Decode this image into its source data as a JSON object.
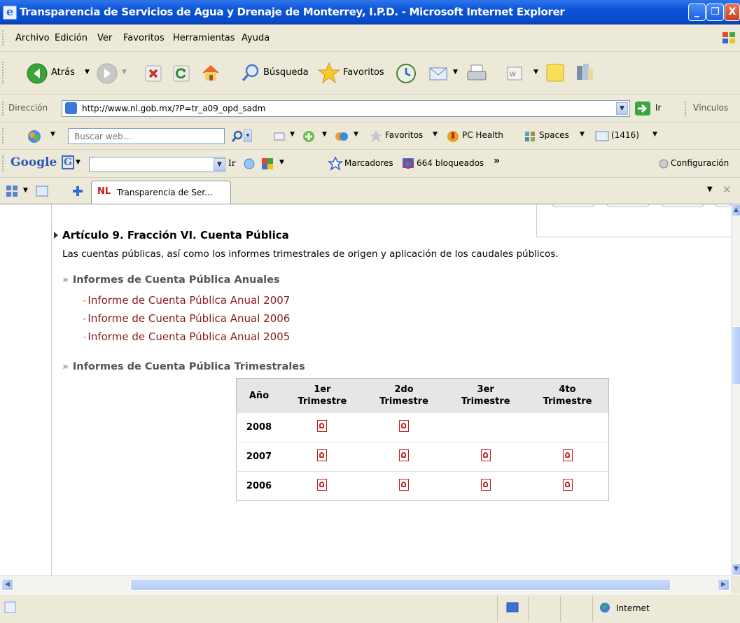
{
  "window": {
    "title": "Transparencia de Servicios de Agua y Drenaje de Monterrey, I.P.D. - Microsoft Internet Explorer",
    "controls": {
      "minimize": "_",
      "maximize": "❐",
      "close": "X"
    }
  },
  "menu": [
    "Archivo",
    "Edición",
    "Ver",
    "Favoritos",
    "Herramientas",
    "Ayuda"
  ],
  "toolbar": {
    "back": "Atrás",
    "search": "Búsqueda",
    "favorites": "Favoritos"
  },
  "address": {
    "label": "Dirección",
    "url": "http://www.nl.gob.mx/?P=tr_a09_opd_sadm",
    "go": "Ir",
    "links": "Vínculos"
  },
  "search_bar": {
    "placeholder": "Buscar web...",
    "favorites": "Favoritos",
    "pc_health": "PC Health",
    "spaces": "Spaces",
    "mail_count": "(1416)"
  },
  "google_bar": {
    "logo": "Google",
    "go": "Ir",
    "bookmarks": "Marcadores",
    "blocked": "664 bloqueados",
    "more": "»",
    "settings": "Configuración"
  },
  "tab": {
    "logo": "NL",
    "label": "Transparencia de Ser..."
  },
  "page": {
    "heading": "Artículo 9. Fracción VI. Cuenta Pública",
    "description": "Las cuentas públicas, así como los informes trimestrales de origen y aplicación de los caudales públicos.",
    "annual_section": "Informes de Cuenta Pública Anuales",
    "annual_links": [
      "Informe de Cuenta Pública Anual 2007",
      "Informe de Cuenta Pública Anual 2006",
      "Informe de Cuenta Pública Anual 2005"
    ],
    "quarterly_section": "Informes de Cuenta Pública Trimestrales",
    "table": {
      "year_header": "Año",
      "quarter_headers": [
        [
          "1er",
          "Trimestre"
        ],
        [
          "2do",
          "Trimestre"
        ],
        [
          "3er",
          "Trimestre"
        ],
        [
          "4to",
          "Trimestre"
        ]
      ],
      "rows": [
        {
          "year": "2008",
          "available": [
            true,
            true,
            false,
            false
          ]
        },
        {
          "year": "2007",
          "available": [
            true,
            true,
            true,
            true
          ]
        },
        {
          "year": "2006",
          "available": [
            true,
            true,
            true,
            true
          ]
        }
      ]
    }
  },
  "status_bar": {
    "zone": "Internet"
  },
  "icons": {
    "pdf": "pdf-file-icon",
    "ie": "ie-page-icon",
    "globe": "internet-globe-icon"
  },
  "colors": {
    "title_bar": "#0b53d8",
    "link": "#8b1a1a",
    "chrome": "#ece9d8"
  }
}
